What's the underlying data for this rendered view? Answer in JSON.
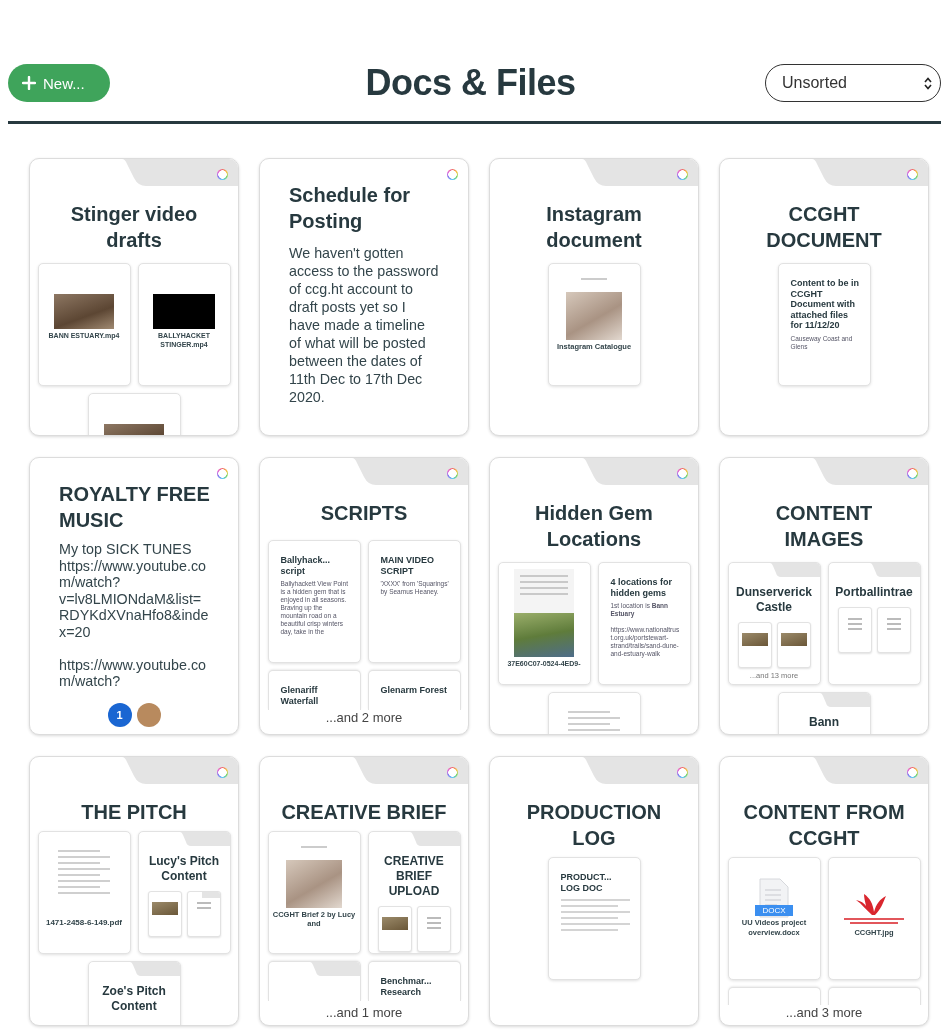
{
  "header": {
    "new_button": "New...",
    "title": "Docs & Files",
    "sort": "Unsorted"
  },
  "cards": [
    {
      "kind": "folder",
      "title": "Stinger video drafts",
      "items": [
        {
          "kind": "photo",
          "name": "BANN ESTUARY.mp4"
        },
        {
          "kind": "video",
          "name": "BALLYHACKET STINGER.mp4"
        },
        {
          "kind": "photo"
        }
      ]
    },
    {
      "kind": "doc",
      "title": "Schedule for Posting",
      "body": "We haven't gotten access to the password of ccg.ht account to draft posts yet so I have made a timeline of what will be posted between the dates of 11th Dec to 17th Dec 2020."
    },
    {
      "kind": "folder",
      "title": "Instagram document",
      "items": [
        {
          "kind": "page",
          "name": "Instagram Catalogue"
        }
      ]
    },
    {
      "kind": "folder",
      "title": "CCGHT DOCUMENT",
      "items": [
        {
          "kind": "note",
          "name": "Content to be in CCGHT Document with attached files for 11/12/20",
          "text": "Causeway Coast and Glens"
        }
      ]
    },
    {
      "kind": "doc",
      "title": "ROYALTY FREE MUSIC",
      "body": "My top SICK TUNES https://www.youtube.com/watch?v=lv8LMIONdaM&list=RDYKdXVnaHfo8&index=20\n\nhttps://www.youtube.com/watch?",
      "comments": "1"
    },
    {
      "kind": "folder",
      "title": "SCRIPTS",
      "items": [
        {
          "kind": "note",
          "name": "Ballyhack... script",
          "text": "Ballyhackett View Point is a hidden gem that is enjoyed in all seasons. Braving up the mountain road on a beautiful crisp winters day, take in the"
        },
        {
          "kind": "note",
          "name": "MAIN VIDEO SCRIPT",
          "text": "'XXXX' from 'Squarings' by Seamus Heaney."
        },
        {
          "kind": "note",
          "name": "Glenariff Waterfall"
        },
        {
          "kind": "note",
          "name": "Glenarm Forest"
        }
      ],
      "more": "...and 2 more"
    },
    {
      "kind": "folder",
      "title": "Hidden Gem Locations",
      "items": [
        {
          "kind": "scan",
          "name": "37E60C07-0524-4ED9-"
        },
        {
          "kind": "note",
          "name": "4 locations for hidden gems",
          "text": "1st location is **Bann Estuary**\n\nhttps://www.nationaltrust.org.uk/portstewart-strand/trails/sand-dune-and-estuary-walk"
        },
        {
          "kind": "textpage"
        }
      ]
    },
    {
      "kind": "folder",
      "title": "CONTENT IMAGES",
      "items": [
        {
          "kind": "folder",
          "name": "Dunserverick Castle",
          "items": [
            {
              "kind": "photo"
            },
            {
              "kind": "photo"
            }
          ],
          "more": "...and 13 more"
        },
        {
          "kind": "folder",
          "name": "Portballintrae",
          "items": [
            {
              "kind": "note"
            },
            {
              "kind": "note"
            }
          ]
        },
        {
          "kind": "folder",
          "name": "Bann"
        }
      ]
    },
    {
      "kind": "folder",
      "title": "THE PITCH",
      "items": [
        {
          "kind": "textpage",
          "name": "1471-2458-6-149.pdf"
        },
        {
          "kind": "folder",
          "name": "Lucy's Pitch Content",
          "items": [
            {
              "kind": "photo"
            },
            {
              "kind": "folder"
            }
          ]
        },
        {
          "kind": "folder",
          "name": "Zoe's Pitch Content"
        }
      ]
    },
    {
      "kind": "folder",
      "title": "CREATIVE BRIEF",
      "items": [
        {
          "kind": "page",
          "name": "CCGHT Brief 2 by Lucy and"
        },
        {
          "kind": "folder",
          "name": "CREATIVE BRIEF UPLOAD",
          "items": [
            {
              "kind": "photo"
            },
            {
              "kind": "note"
            }
          ]
        },
        {
          "kind": "folder"
        },
        {
          "kind": "note",
          "name": "Benchmar... Research"
        }
      ],
      "more": "...and 1 more"
    },
    {
      "kind": "folder",
      "title": "PRODUCTION LOG",
      "items": [
        {
          "kind": "note",
          "name": "PRODUCT... LOG DOC"
        }
      ]
    },
    {
      "kind": "folder",
      "title": "CONTENT FROM CCGHT",
      "items": [
        {
          "kind": "docx",
          "name": "UU Videos project overview.docx",
          "badge": "DOCX"
        },
        {
          "kind": "logo",
          "name": "CCGHT.jpg"
        },
        {
          "kind": "blank"
        },
        {
          "kind": "blank"
        }
      ],
      "more": "...and 3 more"
    }
  ]
}
